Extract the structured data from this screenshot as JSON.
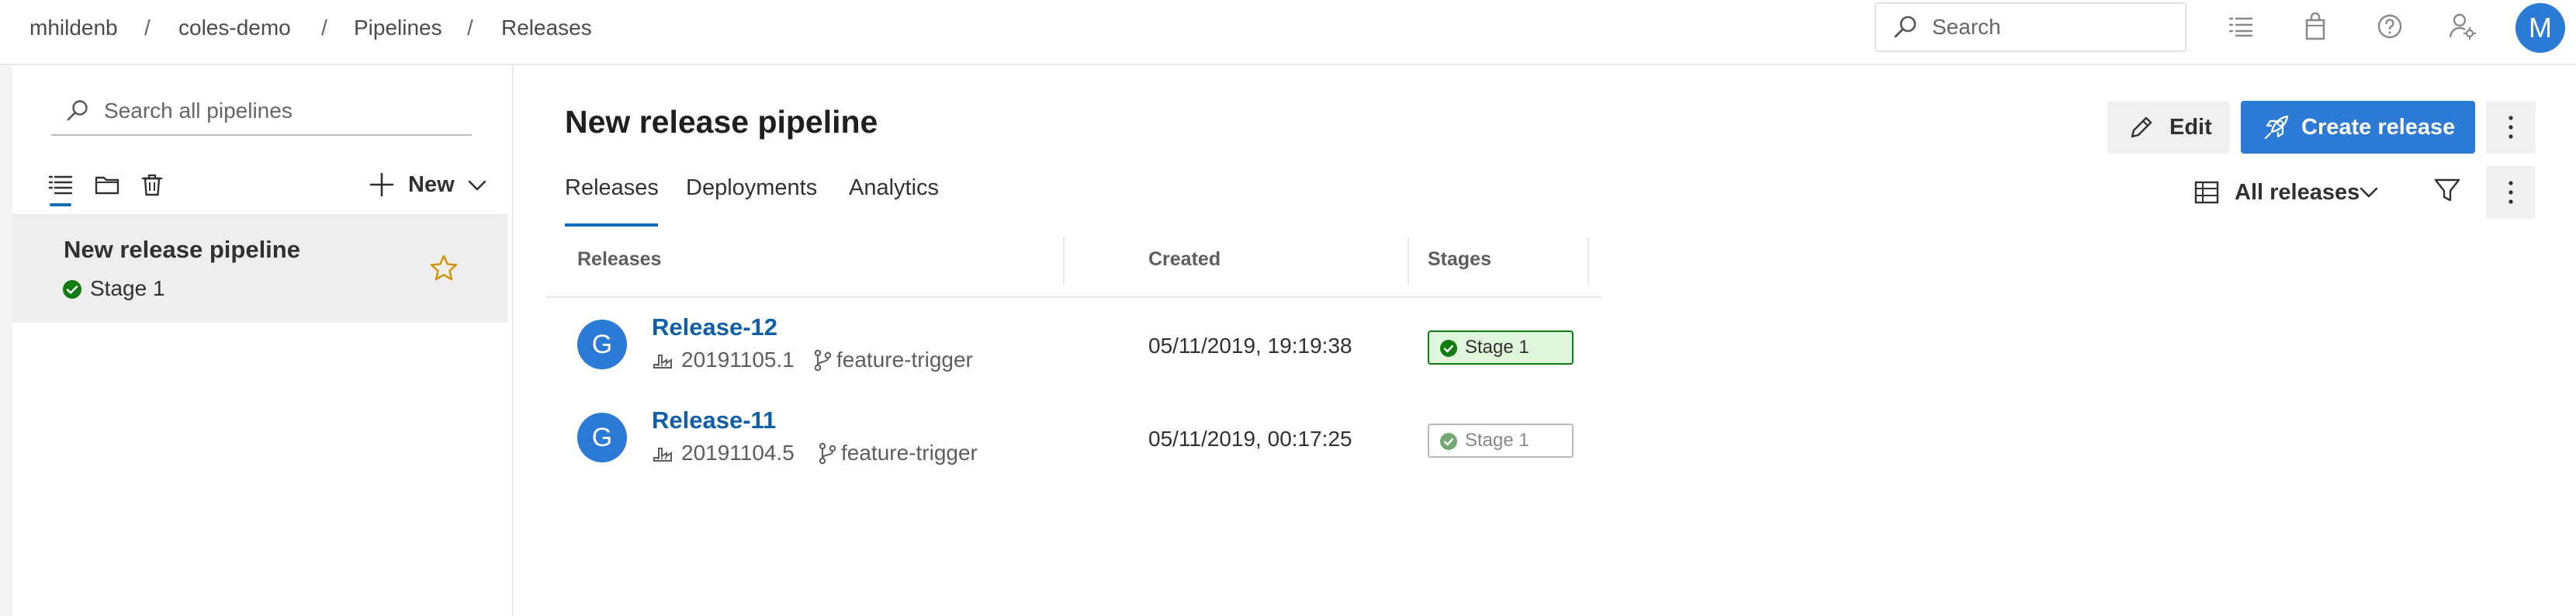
{
  "breadcrumb": {
    "items": [
      "mhildenb",
      "coles-demo",
      "Pipelines",
      "Releases"
    ],
    "separator": "/"
  },
  "topbar": {
    "search_placeholder": "Search",
    "avatar_initial": "M",
    "icons": [
      "search-icon",
      "task-list-icon",
      "marketplace-bag-icon",
      "help-icon",
      "user-settings-icon"
    ]
  },
  "sidebar": {
    "search_placeholder": "Search all pipelines",
    "new_label": "New",
    "tool_icons": [
      "list-view-icon",
      "folder-view-icon",
      "deleted-icon"
    ],
    "pipelines": [
      {
        "name": "New release pipeline",
        "stage": "Stage 1",
        "stage_status": "succeeded"
      }
    ]
  },
  "main": {
    "title": "New release pipeline",
    "tabs": [
      "Releases",
      "Deployments",
      "Analytics"
    ],
    "active_tab": "Releases",
    "edit_label": "Edit",
    "create_label": "Create release",
    "filter_label": "All releases",
    "table": {
      "columns": [
        "Releases",
        "Created",
        "Stages"
      ],
      "rows": [
        {
          "avatar": "G",
          "name": "Release-12",
          "build": "20191105.1",
          "branch": "feature-trigger",
          "created": "05/11/2019, 19:19:38",
          "stage": "Stage 1",
          "stage_state": "active"
        },
        {
          "avatar": "G",
          "name": "Release-11",
          "build": "20191104.5",
          "branch": "feature-trigger",
          "created": "05/11/2019, 00:17:25",
          "stage": "Stage 1",
          "stage_state": "inactive"
        }
      ]
    }
  },
  "colors": {
    "accent": "#2b7bd6",
    "link": "#0f5fa8",
    "success": "#107c10",
    "success_bg": "#dff6dd",
    "star": "#d29200"
  }
}
